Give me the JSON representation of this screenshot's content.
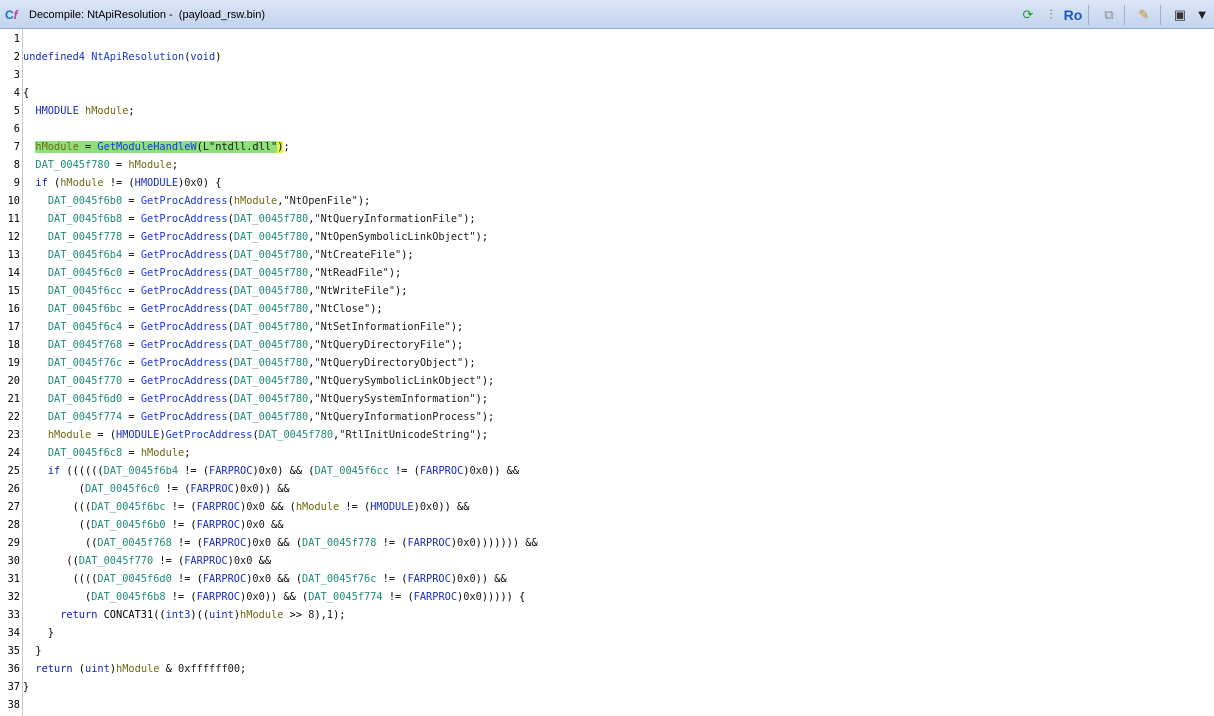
{
  "window": {
    "title": "Decompile: NtApiResolution -  (payload_rsw.bin)",
    "title_icon_letters": [
      "C",
      "f"
    ],
    "toolbar": [
      {
        "name": "refresh-button",
        "icon": "refresh-icon",
        "glyph": "⟳",
        "color": "#1f9a2e"
      },
      {
        "name": "graph-button",
        "icon": "function-graph-icon",
        "glyph": "⫶",
        "color": "#2b7a2b"
      },
      {
        "name": "read-only-button",
        "icon": "read-only-icon",
        "glyph": "Ro",
        "color": "#1b56c4"
      },
      {
        "name": "copy-button",
        "icon": "copy-icon",
        "glyph": "⧉",
        "color": "#8a8a8a"
      },
      {
        "name": "edit-button",
        "icon": "edit-icon",
        "glyph": "✎",
        "color": "#c88a1a"
      },
      {
        "name": "snapshot-button",
        "icon": "camera-icon",
        "glyph": "▣",
        "color": "#333333"
      },
      {
        "name": "menu-button",
        "icon": "chevron-down-icon",
        "glyph": "▼",
        "color": "#222222"
      }
    ]
  },
  "code": [
    {
      "n": "1",
      "tokens": []
    },
    {
      "n": "2",
      "tokens": [
        [
          "type",
          "undefined4"
        ],
        [
          "plain",
          " "
        ],
        [
          "fn",
          "NtApiResolution"
        ],
        [
          "plain",
          "("
        ],
        [
          "type",
          "void"
        ],
        [
          "plain",
          ")"
        ]
      ]
    },
    {
      "n": "3",
      "tokens": []
    },
    {
      "n": "4",
      "tokens": [
        [
          "plain",
          "{"
        ]
      ]
    },
    {
      "n": "5",
      "tokens": [
        [
          "plain",
          "  "
        ],
        [
          "type",
          "HMODULE"
        ],
        [
          "plain",
          " "
        ],
        [
          "var",
          "hModule"
        ],
        [
          "plain",
          ";"
        ]
      ]
    },
    {
      "n": "6",
      "tokens": []
    },
    {
      "n": "7",
      "highlight": true,
      "tokens": [
        [
          "plain",
          "  "
        ],
        [
          "var",
          "hModule"
        ],
        [
          "plain",
          " = "
        ],
        [
          "fn",
          "GetModuleHandleW"
        ],
        [
          "plain",
          "("
        ],
        [
          "str",
          "L\"ntdll.dll\""
        ],
        [
          "cursor",
          ")"
        ],
        [
          "plain",
          ";"
        ]
      ]
    },
    {
      "n": "8",
      "tokens": [
        [
          "plain",
          "  "
        ],
        [
          "glob",
          "DAT_0045f780"
        ],
        [
          "plain",
          " = "
        ],
        [
          "var",
          "hModule"
        ],
        [
          "plain",
          ";"
        ]
      ]
    },
    {
      "n": "9",
      "tokens": [
        [
          "plain",
          "  "
        ],
        [
          "kw",
          "if"
        ],
        [
          "plain",
          " ("
        ],
        [
          "var",
          "hModule"
        ],
        [
          "plain",
          " != ("
        ],
        [
          "type",
          "HMODULE"
        ],
        [
          "plain",
          ")"
        ],
        [
          "num",
          "0x0"
        ],
        [
          "plain",
          ") {"
        ]
      ]
    },
    {
      "n": "10",
      "tokens": [
        [
          "plain",
          "    "
        ],
        [
          "glob",
          "DAT_0045f6b0"
        ],
        [
          "plain",
          " = "
        ],
        [
          "fn",
          "GetProcAddress"
        ],
        [
          "plain",
          "("
        ],
        [
          "var",
          "hModule"
        ],
        [
          "plain",
          ","
        ],
        [
          "str",
          "\"NtOpenFile\""
        ],
        [
          "plain",
          ");"
        ]
      ]
    },
    {
      "n": "11",
      "tokens": [
        [
          "plain",
          "    "
        ],
        [
          "glob",
          "DAT_0045f6b8"
        ],
        [
          "plain",
          " = "
        ],
        [
          "fn",
          "GetProcAddress"
        ],
        [
          "plain",
          "("
        ],
        [
          "glob",
          "DAT_0045f780"
        ],
        [
          "plain",
          ","
        ],
        [
          "str",
          "\"NtQueryInformationFile\""
        ],
        [
          "plain",
          ");"
        ]
      ]
    },
    {
      "n": "12",
      "tokens": [
        [
          "plain",
          "    "
        ],
        [
          "glob",
          "DAT_0045f778"
        ],
        [
          "plain",
          " = "
        ],
        [
          "fn",
          "GetProcAddress"
        ],
        [
          "plain",
          "("
        ],
        [
          "glob",
          "DAT_0045f780"
        ],
        [
          "plain",
          ","
        ],
        [
          "str",
          "\"NtOpenSymbolicLinkObject\""
        ],
        [
          "plain",
          ");"
        ]
      ]
    },
    {
      "n": "13",
      "tokens": [
        [
          "plain",
          "    "
        ],
        [
          "glob",
          "DAT_0045f6b4"
        ],
        [
          "plain",
          " = "
        ],
        [
          "fn",
          "GetProcAddress"
        ],
        [
          "plain",
          "("
        ],
        [
          "glob",
          "DAT_0045f780"
        ],
        [
          "plain",
          ","
        ],
        [
          "str",
          "\"NtCreateFile\""
        ],
        [
          "plain",
          ");"
        ]
      ]
    },
    {
      "n": "14",
      "tokens": [
        [
          "plain",
          "    "
        ],
        [
          "glob",
          "DAT_0045f6c0"
        ],
        [
          "plain",
          " = "
        ],
        [
          "fn",
          "GetProcAddress"
        ],
        [
          "plain",
          "("
        ],
        [
          "glob",
          "DAT_0045f780"
        ],
        [
          "plain",
          ","
        ],
        [
          "str",
          "\"NtReadFile\""
        ],
        [
          "plain",
          ");"
        ]
      ]
    },
    {
      "n": "15",
      "tokens": [
        [
          "plain",
          "    "
        ],
        [
          "glob",
          "DAT_0045f6cc"
        ],
        [
          "plain",
          " = "
        ],
        [
          "fn",
          "GetProcAddress"
        ],
        [
          "plain",
          "("
        ],
        [
          "glob",
          "DAT_0045f780"
        ],
        [
          "plain",
          ","
        ],
        [
          "str",
          "\"NtWriteFile\""
        ],
        [
          "plain",
          ");"
        ]
      ]
    },
    {
      "n": "16",
      "tokens": [
        [
          "plain",
          "    "
        ],
        [
          "glob",
          "DAT_0045f6bc"
        ],
        [
          "plain",
          " = "
        ],
        [
          "fn",
          "GetProcAddress"
        ],
        [
          "plain",
          "("
        ],
        [
          "glob",
          "DAT_0045f780"
        ],
        [
          "plain",
          ","
        ],
        [
          "str",
          "\"NtClose\""
        ],
        [
          "plain",
          ");"
        ]
      ]
    },
    {
      "n": "17",
      "tokens": [
        [
          "plain",
          "    "
        ],
        [
          "glob",
          "DAT_0045f6c4"
        ],
        [
          "plain",
          " = "
        ],
        [
          "fn",
          "GetProcAddress"
        ],
        [
          "plain",
          "("
        ],
        [
          "glob",
          "DAT_0045f780"
        ],
        [
          "plain",
          ","
        ],
        [
          "str",
          "\"NtSetInformationFile\""
        ],
        [
          "plain",
          ");"
        ]
      ]
    },
    {
      "n": "18",
      "tokens": [
        [
          "plain",
          "    "
        ],
        [
          "glob",
          "DAT_0045f768"
        ],
        [
          "plain",
          " = "
        ],
        [
          "fn",
          "GetProcAddress"
        ],
        [
          "plain",
          "("
        ],
        [
          "glob",
          "DAT_0045f780"
        ],
        [
          "plain",
          ","
        ],
        [
          "str",
          "\"NtQueryDirectoryFile\""
        ],
        [
          "plain",
          ");"
        ]
      ]
    },
    {
      "n": "19",
      "tokens": [
        [
          "plain",
          "    "
        ],
        [
          "glob",
          "DAT_0045f76c"
        ],
        [
          "plain",
          " = "
        ],
        [
          "fn",
          "GetProcAddress"
        ],
        [
          "plain",
          "("
        ],
        [
          "glob",
          "DAT_0045f780"
        ],
        [
          "plain",
          ","
        ],
        [
          "str",
          "\"NtQueryDirectoryObject\""
        ],
        [
          "plain",
          ");"
        ]
      ]
    },
    {
      "n": "20",
      "tokens": [
        [
          "plain",
          "    "
        ],
        [
          "glob",
          "DAT_0045f770"
        ],
        [
          "plain",
          " = "
        ],
        [
          "fn",
          "GetProcAddress"
        ],
        [
          "plain",
          "("
        ],
        [
          "glob",
          "DAT_0045f780"
        ],
        [
          "plain",
          ","
        ],
        [
          "str",
          "\"NtQuerySymbolicLinkObject\""
        ],
        [
          "plain",
          ");"
        ]
      ]
    },
    {
      "n": "21",
      "tokens": [
        [
          "plain",
          "    "
        ],
        [
          "glob",
          "DAT_0045f6d0"
        ],
        [
          "plain",
          " = "
        ],
        [
          "fn",
          "GetProcAddress"
        ],
        [
          "plain",
          "("
        ],
        [
          "glob",
          "DAT_0045f780"
        ],
        [
          "plain",
          ","
        ],
        [
          "str",
          "\"NtQuerySystemInformation\""
        ],
        [
          "plain",
          ");"
        ]
      ]
    },
    {
      "n": "22",
      "tokens": [
        [
          "plain",
          "    "
        ],
        [
          "glob",
          "DAT_0045f774"
        ],
        [
          "plain",
          " = "
        ],
        [
          "fn",
          "GetProcAddress"
        ],
        [
          "plain",
          "("
        ],
        [
          "glob",
          "DAT_0045f780"
        ],
        [
          "plain",
          ","
        ],
        [
          "str",
          "\"NtQueryInformationProcess\""
        ],
        [
          "plain",
          ");"
        ]
      ]
    },
    {
      "n": "23",
      "tokens": [
        [
          "plain",
          "    "
        ],
        [
          "var",
          "hModule"
        ],
        [
          "plain",
          " = ("
        ],
        [
          "type",
          "HMODULE"
        ],
        [
          "plain",
          ")"
        ],
        [
          "fn",
          "GetProcAddress"
        ],
        [
          "plain",
          "("
        ],
        [
          "glob",
          "DAT_0045f780"
        ],
        [
          "plain",
          ","
        ],
        [
          "str",
          "\"RtlInitUnicodeString\""
        ],
        [
          "plain",
          ");"
        ]
      ]
    },
    {
      "n": "24",
      "tokens": [
        [
          "plain",
          "    "
        ],
        [
          "glob",
          "DAT_0045f6c8"
        ],
        [
          "plain",
          " = "
        ],
        [
          "var",
          "hModule"
        ],
        [
          "plain",
          ";"
        ]
      ]
    },
    {
      "n": "25",
      "tokens": [
        [
          "plain",
          "    "
        ],
        [
          "kw",
          "if"
        ],
        [
          "plain",
          " (((((("
        ],
        [
          "glob",
          "DAT_0045f6b4"
        ],
        [
          "plain",
          " != ("
        ],
        [
          "type",
          "FARPROC"
        ],
        [
          "plain",
          ")"
        ],
        [
          "num",
          "0x0"
        ],
        [
          "plain",
          ") && ("
        ],
        [
          "glob",
          "DAT_0045f6cc"
        ],
        [
          "plain",
          " != ("
        ],
        [
          "type",
          "FARPROC"
        ],
        [
          "plain",
          ")"
        ],
        [
          "num",
          "0x0"
        ],
        [
          "plain",
          ")) &&"
        ]
      ]
    },
    {
      "n": "26",
      "tokens": [
        [
          "plain",
          "         ("
        ],
        [
          "glob",
          "DAT_0045f6c0"
        ],
        [
          "plain",
          " != ("
        ],
        [
          "type",
          "FARPROC"
        ],
        [
          "plain",
          ")"
        ],
        [
          "num",
          "0x0"
        ],
        [
          "plain",
          ")) &&"
        ]
      ]
    },
    {
      "n": "27",
      "tokens": [
        [
          "plain",
          "        ((("
        ],
        [
          "glob",
          "DAT_0045f6bc"
        ],
        [
          "plain",
          " != ("
        ],
        [
          "type",
          "FARPROC"
        ],
        [
          "plain",
          ")"
        ],
        [
          "num",
          "0x0"
        ],
        [
          "plain",
          " && ("
        ],
        [
          "var",
          "hModule"
        ],
        [
          "plain",
          " != ("
        ],
        [
          "type",
          "HMODULE"
        ],
        [
          "plain",
          ")"
        ],
        [
          "num",
          "0x0"
        ],
        [
          "plain",
          ")) &&"
        ]
      ]
    },
    {
      "n": "28",
      "tokens": [
        [
          "plain",
          "         (("
        ],
        [
          "glob",
          "DAT_0045f6b0"
        ],
        [
          "plain",
          " != ("
        ],
        [
          "type",
          "FARPROC"
        ],
        [
          "plain",
          ")"
        ],
        [
          "num",
          "0x0"
        ],
        [
          "plain",
          " &&"
        ]
      ]
    },
    {
      "n": "29",
      "tokens": [
        [
          "plain",
          "          (("
        ],
        [
          "glob",
          "DAT_0045f768"
        ],
        [
          "plain",
          " != ("
        ],
        [
          "type",
          "FARPROC"
        ],
        [
          "plain",
          ")"
        ],
        [
          "num",
          "0x0"
        ],
        [
          "plain",
          " && ("
        ],
        [
          "glob",
          "DAT_0045f778"
        ],
        [
          "plain",
          " != ("
        ],
        [
          "type",
          "FARPROC"
        ],
        [
          "plain",
          ")"
        ],
        [
          "num",
          "0x0"
        ],
        [
          "plain",
          "))))))) &&"
        ]
      ]
    },
    {
      "n": "30",
      "tokens": [
        [
          "plain",
          "       (("
        ],
        [
          "glob",
          "DAT_0045f770"
        ],
        [
          "plain",
          " != ("
        ],
        [
          "type",
          "FARPROC"
        ],
        [
          "plain",
          ")"
        ],
        [
          "num",
          "0x0"
        ],
        [
          "plain",
          " &&"
        ]
      ]
    },
    {
      "n": "31",
      "tokens": [
        [
          "plain",
          "        (((("
        ],
        [
          "glob",
          "DAT_0045f6d0"
        ],
        [
          "plain",
          " != ("
        ],
        [
          "type",
          "FARPROC"
        ],
        [
          "plain",
          ")"
        ],
        [
          "num",
          "0x0"
        ],
        [
          "plain",
          " && ("
        ],
        [
          "glob",
          "DAT_0045f76c"
        ],
        [
          "plain",
          " != ("
        ],
        [
          "type",
          "FARPROC"
        ],
        [
          "plain",
          ")"
        ],
        [
          "num",
          "0x0"
        ],
        [
          "plain",
          ")) &&"
        ]
      ]
    },
    {
      "n": "32",
      "tokens": [
        [
          "plain",
          "          ("
        ],
        [
          "glob",
          "DAT_0045f6b8"
        ],
        [
          "plain",
          " != ("
        ],
        [
          "type",
          "FARPROC"
        ],
        [
          "plain",
          ")"
        ],
        [
          "num",
          "0x0"
        ],
        [
          "plain",
          ")) && ("
        ],
        [
          "glob",
          "DAT_0045f774"
        ],
        [
          "plain",
          " != ("
        ],
        [
          "type",
          "FARPROC"
        ],
        [
          "plain",
          ")"
        ],
        [
          "num",
          "0x0"
        ],
        [
          "plain",
          "))))) {"
        ]
      ]
    },
    {
      "n": "33",
      "tokens": [
        [
          "plain",
          "      "
        ],
        [
          "kw",
          "return"
        ],
        [
          "plain",
          " CONCAT31(("
        ],
        [
          "type",
          "int3"
        ],
        [
          "plain",
          ")(("
        ],
        [
          "type",
          "uint"
        ],
        [
          "plain",
          ")"
        ],
        [
          "var",
          "hModule"
        ],
        [
          "plain",
          " >> "
        ],
        [
          "num",
          "8"
        ],
        [
          "plain",
          "),"
        ],
        [
          "num",
          "1"
        ],
        [
          "plain",
          ");"
        ]
      ]
    },
    {
      "n": "34",
      "tokens": [
        [
          "plain",
          "    }"
        ]
      ]
    },
    {
      "n": "35",
      "tokens": [
        [
          "plain",
          "  }"
        ]
      ]
    },
    {
      "n": "36",
      "tokens": [
        [
          "plain",
          "  "
        ],
        [
          "kw",
          "return"
        ],
        [
          "plain",
          " ("
        ],
        [
          "type",
          "uint"
        ],
        [
          "plain",
          ")"
        ],
        [
          "var",
          "hModule"
        ],
        [
          "plain",
          " & "
        ],
        [
          "num",
          "0xffffff00"
        ],
        [
          "plain",
          ";"
        ]
      ]
    },
    {
      "n": "37",
      "tokens": [
        [
          "plain",
          "}"
        ]
      ]
    },
    {
      "n": "38",
      "tokens": []
    }
  ]
}
